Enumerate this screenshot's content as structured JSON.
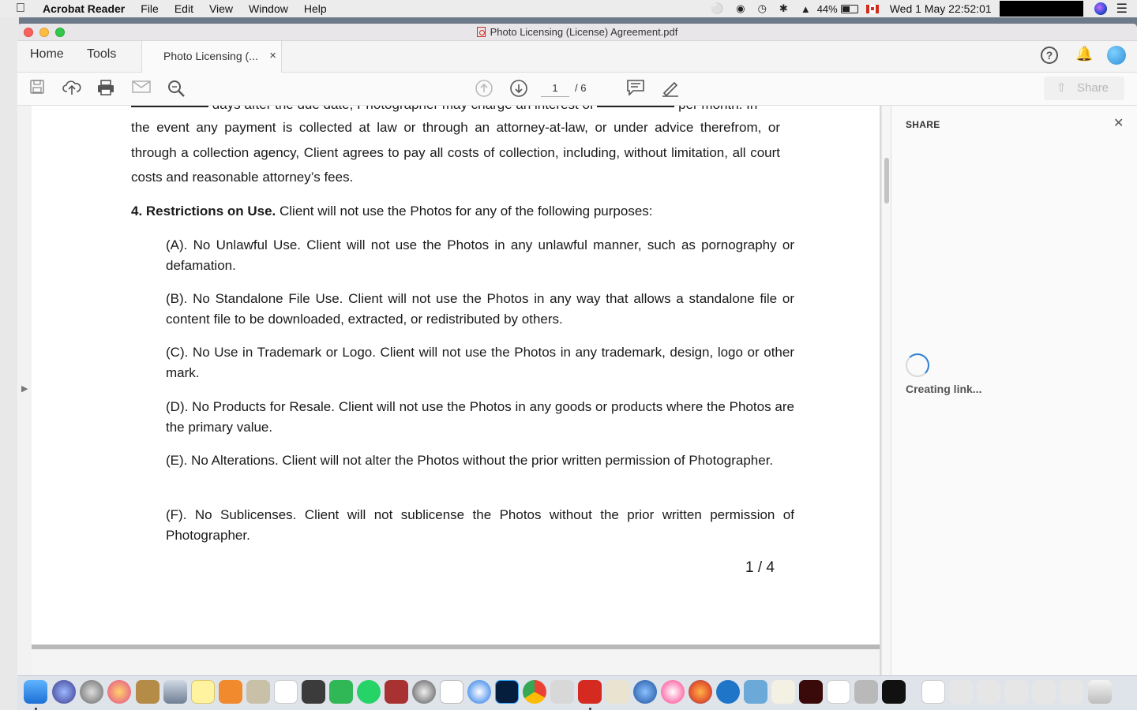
{
  "menubar": {
    "app_name": "Acrobat Reader",
    "menus": [
      "File",
      "Edit",
      "View",
      "Window",
      "Help"
    ],
    "battery": "44%",
    "datetime": "Wed 1 May  22:52:01"
  },
  "window": {
    "title": "Photo Licensing (License) Agreement.pdf"
  },
  "tabs": {
    "home": "Home",
    "tools": "Tools",
    "document_tab": "Photo Licensing (...",
    "close": "×",
    "help": "?"
  },
  "toolbar": {
    "current_page": "1",
    "total_pages": "/ 6",
    "share_label": "Share"
  },
  "document": {
    "top_line_a": "days after the due date, Photographer may charge an interest of",
    "top_line_b": "per month. In",
    "para_collection": "the event any payment is collected at law or through an attorney-at-law, or under advice therefrom, or through a collection agency, Client agrees to pay all costs of collection, including, without limitation, all court costs and reasonable attorney’s fees.",
    "section4_heading": "4. Restrictions on Use.",
    "section4_intro": " Client will not use the Photos for any of the following purposes:",
    "items": [
      "(A). No Unlawful Use. Client will not use the Photos in any unlawful manner, such as pornography or defamation.",
      "(B). No Standalone File Use. Client will not use the Photos in any way that allows a standalone file or content file to be downloaded, extracted, or redistributed by others.",
      "(C). No Use in Trademark or Logo. Client will not use the Photos in any trademark, design, logo or other mark.",
      "(D). No Products for Resale. Client will not use the Photos in any goods or products where the Photos are the primary value.",
      "(E). No Alterations. Client will not alter the Photos without the prior written permission of Photographer.",
      "(F). No Sublicenses. Client will not sublicense the Photos without the prior written permission of Photographer."
    ],
    "page_footer": "1 / 4"
  },
  "share_panel": {
    "title": "SHARE",
    "close": "✕",
    "status": "Creating link..."
  }
}
